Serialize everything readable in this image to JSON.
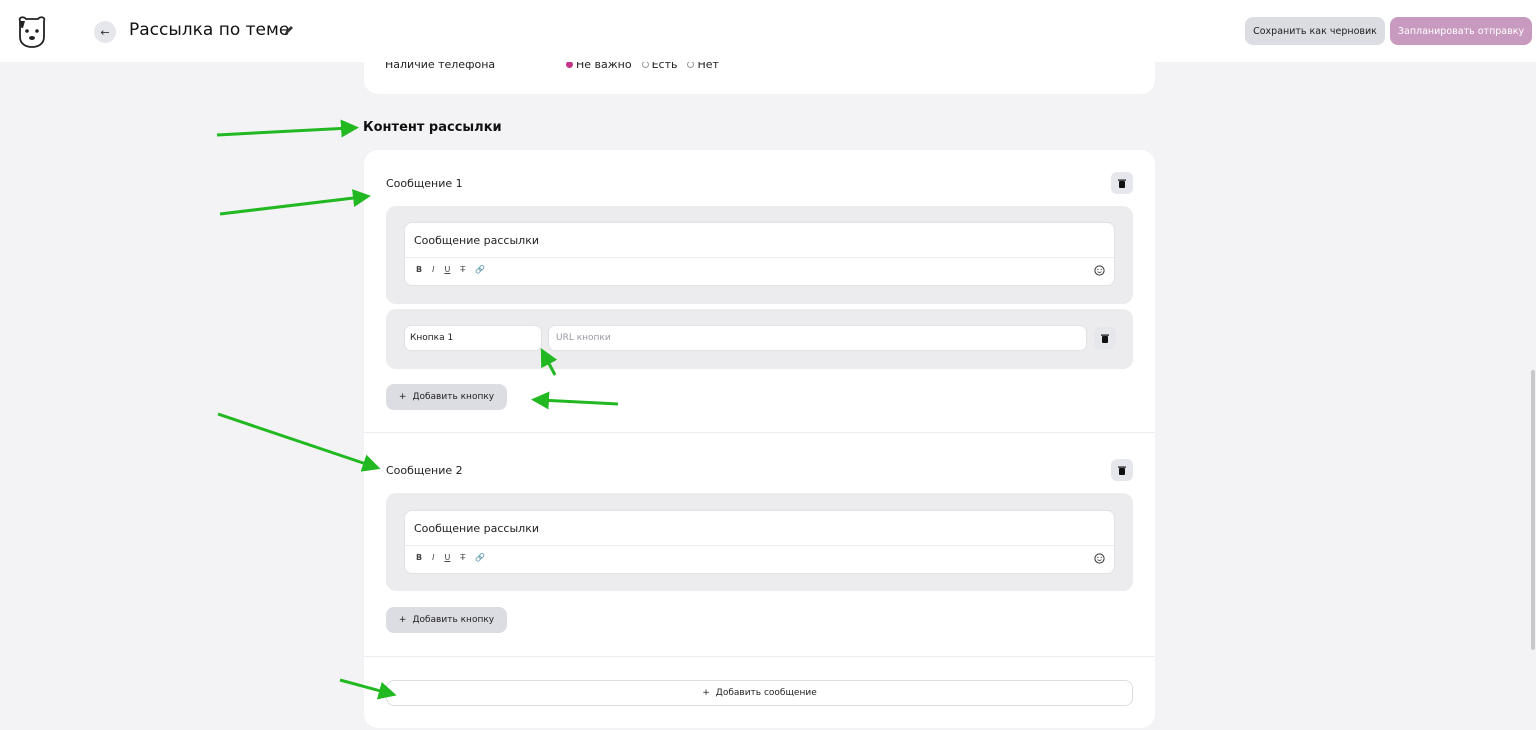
{
  "header": {
    "back_icon": "arrow-left-icon",
    "title": "Рассылка по теме",
    "edit_icon": "pencil-icon",
    "save_draft_label": "Сохранить как черновик",
    "schedule_label": "Запланировать отправку",
    "schedule_color": "#c99abf"
  },
  "filter": {
    "phone_label": "Наличие телефона",
    "options": [
      {
        "label": "Не важно",
        "selected": true
      },
      {
        "label": "Есть",
        "selected": false
      },
      {
        "label": "Нет",
        "selected": false
      }
    ],
    "accent_color": "#c2378a"
  },
  "content": {
    "section_title": "Контент рассылки",
    "messages": [
      {
        "title": "Сообщение 1",
        "text": "Сообщение рассылки",
        "toolbar": [
          "B",
          "I",
          "U",
          "T̶",
          "🔗"
        ],
        "button_name": "Кнопка 1",
        "url_placeholder": "URL кнопки",
        "add_button_label": "Добавить кнопку"
      },
      {
        "title": "Сообщение 2",
        "text": "Сообщение рассылки",
        "toolbar": [
          "B",
          "I",
          "U",
          "T̶",
          "🔗"
        ],
        "add_button_label": "Добавить кнопку"
      }
    ],
    "add_message_label": "Добавить сообщение",
    "plus": "+"
  },
  "annotation_color": "#22b822"
}
